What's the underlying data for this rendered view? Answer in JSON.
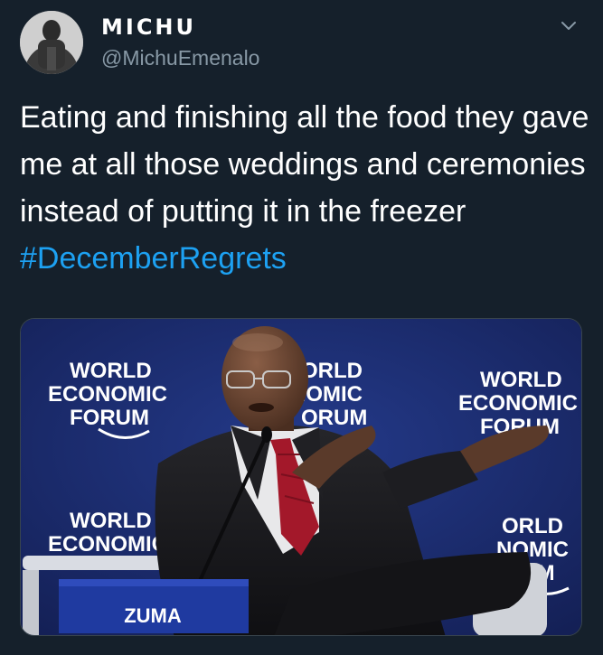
{
  "tweet": {
    "display_name": "MICHU",
    "handle": "@MichuEmenalo",
    "text_main": "Eating and finishing all the food they gave me at all those weddings and ceremonies instead of putting it in the freezer ",
    "hashtag": "#DecemberRegrets",
    "icons": {
      "avatar": "avatar-photo",
      "menu": "chevron-down-icon"
    },
    "colors": {
      "background": "#15202b",
      "text": "#ffffff",
      "secondary": "#8899a6",
      "link": "#1da1f2"
    }
  },
  "media": {
    "backdrop_logo": {
      "line1": "WORLD",
      "line2": "ECONOMIC",
      "line3": "FORUM"
    },
    "partial_logos": {
      "center_l1": "ORLD",
      "center_l2": "NOMIC",
      "center_l3": "ORUM",
      "bottom_left_l1": "WORLD",
      "bottom_left_l2": "ECONOMIC",
      "bottom_right_l1": "ORLD",
      "bottom_right_l2": "NOMIC",
      "bottom_right_l3": "RUM"
    },
    "nameplate": "ZUMA",
    "colors": {
      "backdrop": "#1b2a6b",
      "suit": "#1a1a1c",
      "tie": "#a3182a",
      "shirt": "#e8e8ea",
      "skin": "#5a3a2a"
    }
  }
}
